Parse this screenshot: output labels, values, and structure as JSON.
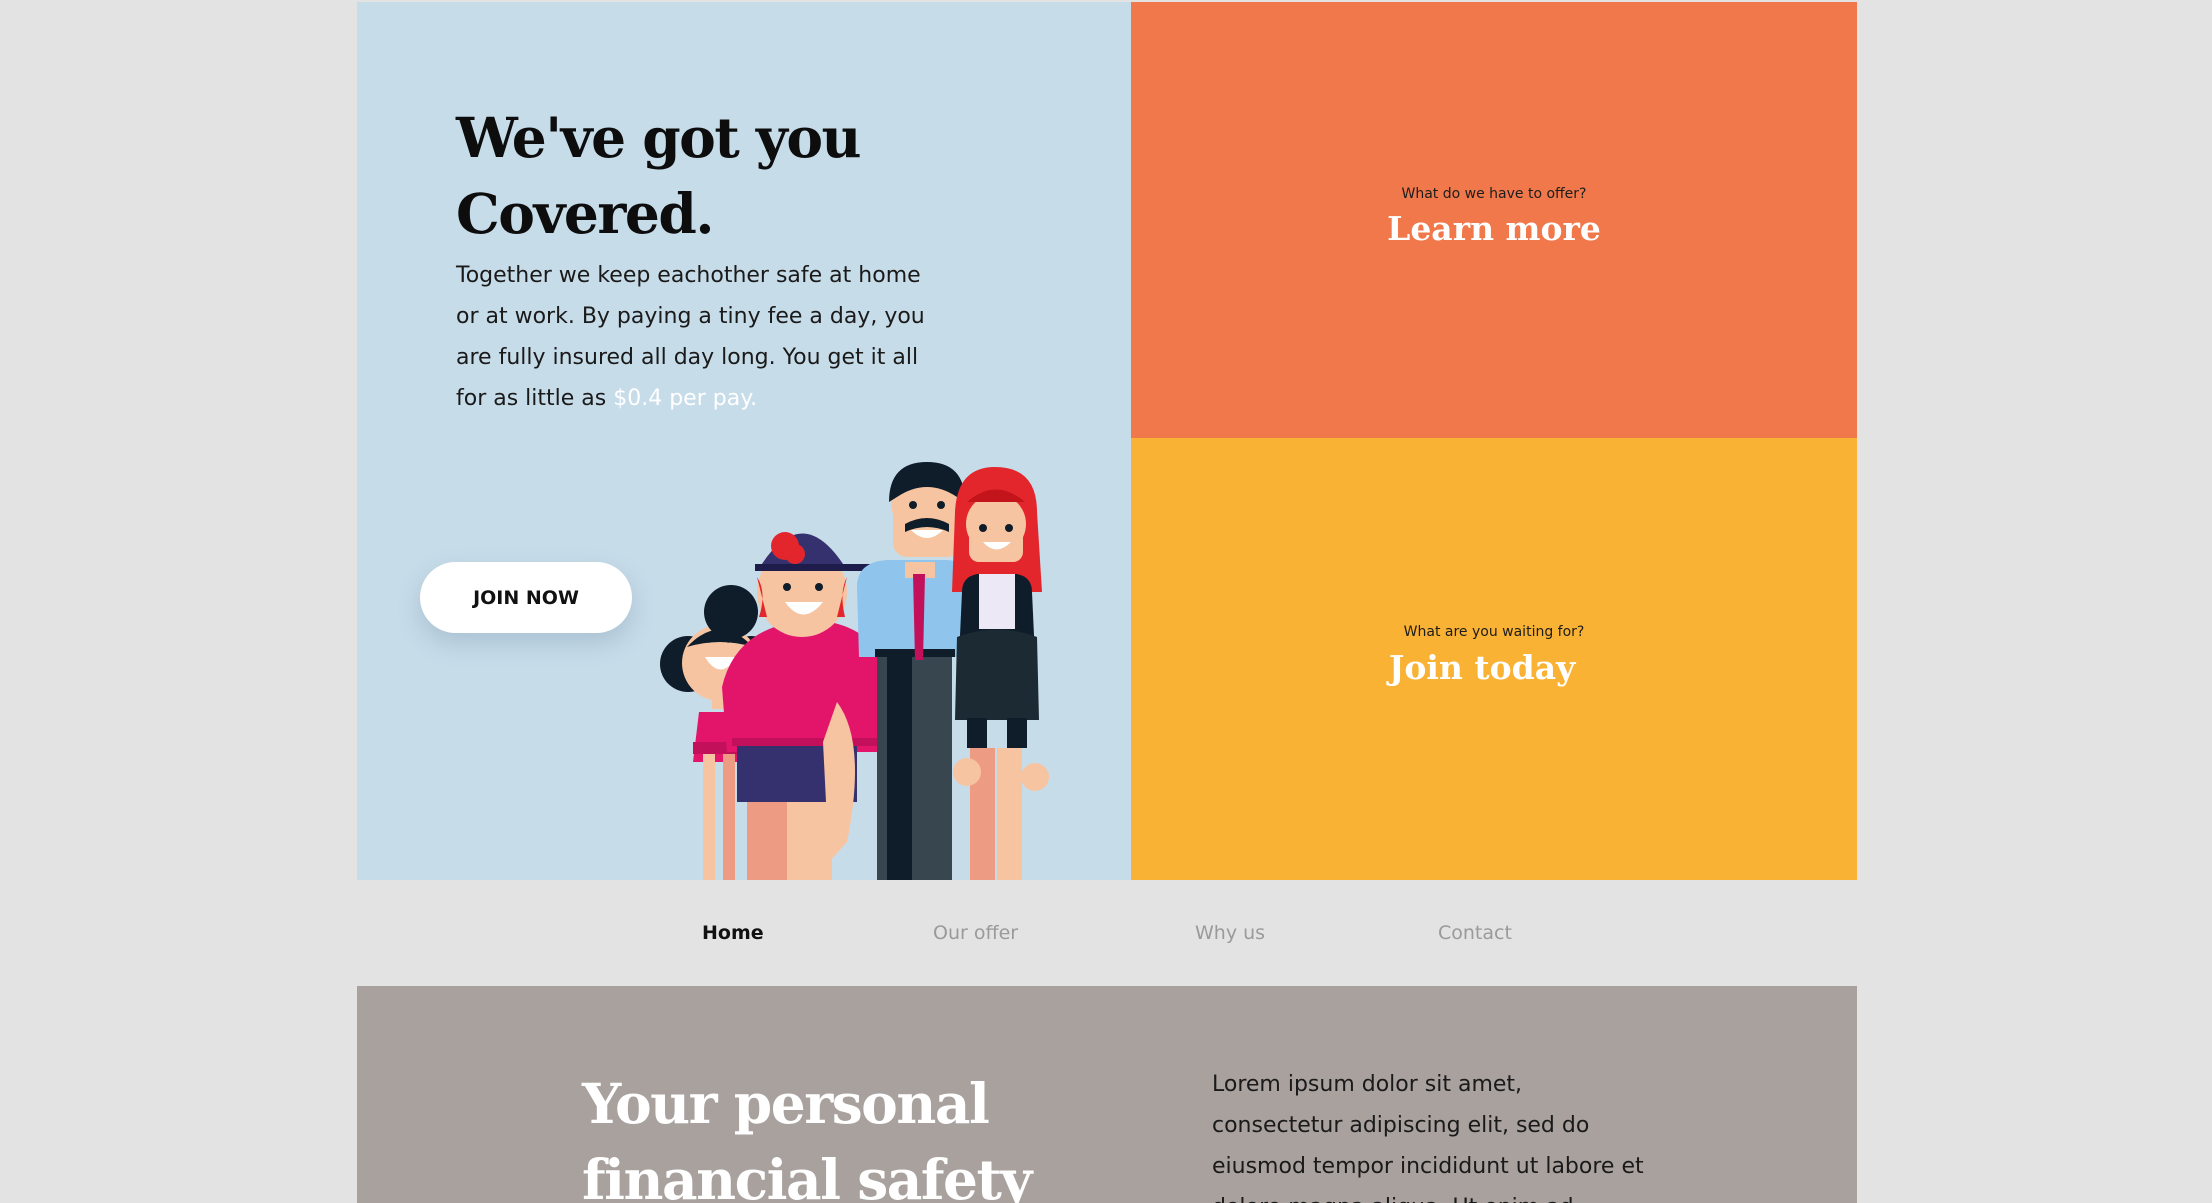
{
  "hero": {
    "title": "We've got you Covered.",
    "text": "Together we keep eachother safe at home or at work. By paying a tiny fee a day, you are fully insured all day long. You get it all for as little as ",
    "price": "$0.4 per pay.",
    "join_label": "JOIN NOW"
  },
  "panels": {
    "learn": {
      "eyebrow": "What do we have to offer?",
      "cta": "Learn more"
    },
    "join": {
      "eyebrow": "What are you waiting for?",
      "cta": "Join today"
    }
  },
  "nav": {
    "items": [
      {
        "label": "Home",
        "active": true
      },
      {
        "label": "Our offer",
        "active": false
      },
      {
        "label": "Why us",
        "active": false
      },
      {
        "label": "Contact",
        "active": false
      }
    ]
  },
  "section2": {
    "title": "Your personal financial safety",
    "text": "Lorem ipsum dolor sit amet, consectetur adipiscing elit, sed do eiusmod tempor incididunt ut labore et dolore magna aliqua. Ut enim ad"
  },
  "colors": {
    "hero_bg": "#c7dce9",
    "orange": "#f0784a",
    "yellow": "#f9b233",
    "section2_bg": "#a8a19e",
    "page_bg": "#e3e3e3"
  }
}
